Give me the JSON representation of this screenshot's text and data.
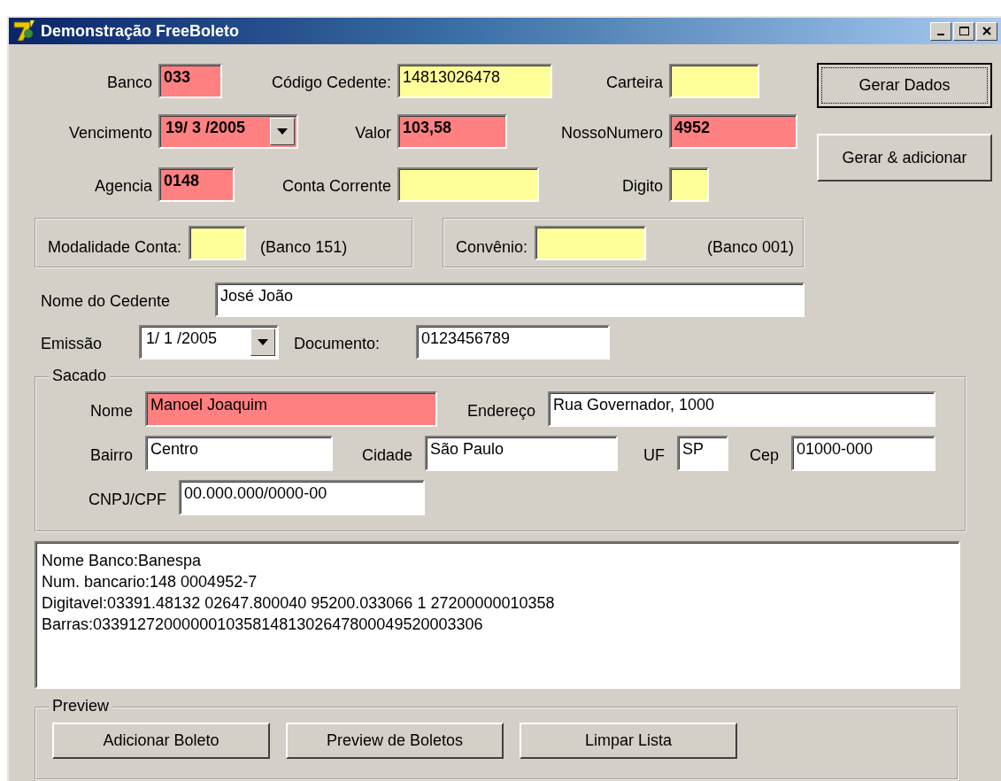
{
  "window": {
    "title": "Demonstração FreeBoleto"
  },
  "cedente_fields": [
    {
      "label": "Banco",
      "value": "033",
      "color": "#ff8080",
      "bold": true,
      "kind": "text"
    },
    {
      "label": "Código Cedente:",
      "value": "14813026478",
      "color": "#ffff99",
      "bold": false,
      "kind": "text"
    },
    {
      "label": "Carteira",
      "color": "#ffff99",
      "kind": "text"
    },
    {
      "label": "Vencimento",
      "value": "19/ 3 /2005",
      "color": "#ff8080",
      "bold": true,
      "kind": "date"
    },
    {
      "label": "Valor",
      "value": "103,58",
      "color": "#ff8080",
      "bold": true,
      "kind": "text"
    },
    {
      "label": "NossoNumero",
      "value": "4952",
      "color": "#ff8080",
      "bold": true,
      "kind": "text"
    },
    {
      "label": "Agencia",
      "value": "0148",
      "color": "#ff8080",
      "bold": true,
      "kind": "text"
    },
    {
      "label": "Conta Corrente",
      "color": "#ffff99",
      "kind": "text"
    },
    {
      "label": "Digito",
      "color": "#ffff99",
      "kind": "text"
    }
  ],
  "actions": [
    {
      "label": "Gerar Dados",
      "focused": true
    },
    {
      "label": "Gerar & adicionar",
      "focused": false
    }
  ],
  "panels": [
    {
      "label": "Modalidade Conta:",
      "color": "#ffff99",
      "note": "(Banco 151)"
    },
    {
      "label": "Convênio:",
      "color": "#ffff99",
      "note": "(Banco 001)"
    }
  ],
  "document_fields": [
    {
      "label": "Nome do Cedente",
      "value": "José João",
      "color": "#ffffff",
      "bold": false,
      "kind": "text"
    },
    {
      "label": "Emissão",
      "value": "1/ 1 /2005",
      "color": "#ffffff",
      "bold": false,
      "kind": "date"
    },
    {
      "label": "Documento:",
      "value": "0123456789",
      "color": "#ffffff",
      "bold": false,
      "kind": "text"
    }
  ],
  "sacado": {
    "title": "Sacado",
    "fields": [
      {
        "label": "Nome",
        "value": "Manoel Joaquim",
        "color": "#ff8080",
        "bold": false,
        "kind": "text"
      },
      {
        "label": "Endereço",
        "value": "Rua Governador, 1000",
        "color": "#ffffff",
        "bold": false,
        "kind": "text"
      },
      {
        "label": "Bairro",
        "value": "Centro",
        "color": "#ffffff",
        "bold": false,
        "kind": "text"
      },
      {
        "label": "Cidade",
        "value": "São Paulo",
        "color": "#ffffff",
        "bold": false,
        "kind": "text"
      },
      {
        "label": "UF",
        "value": "SP",
        "color": "#ffffff",
        "bold": false,
        "kind": "text"
      },
      {
        "label": "Cep",
        "value": "01000-000",
        "color": "#ffffff",
        "bold": false,
        "kind": "text"
      },
      {
        "label": "CNPJ/CPF",
        "value": "00.000.000/0000-00",
        "color": "#ffffff",
        "bold": false,
        "kind": "text"
      }
    ]
  },
  "output": {
    "lines": [
      "Nome Banco:Banespa",
      "Num. bancario:148 0004952-7",
      "Digitavel:03391.48132 02647.800040 95200.033066 1 27200000010358",
      "Barras:03391272000000103581481302647800049520003306"
    ]
  },
  "preview": {
    "title": "Preview",
    "buttons": [
      "Adicionar Boleto",
      "Preview de Boletos",
      "Limpar Lista"
    ]
  }
}
